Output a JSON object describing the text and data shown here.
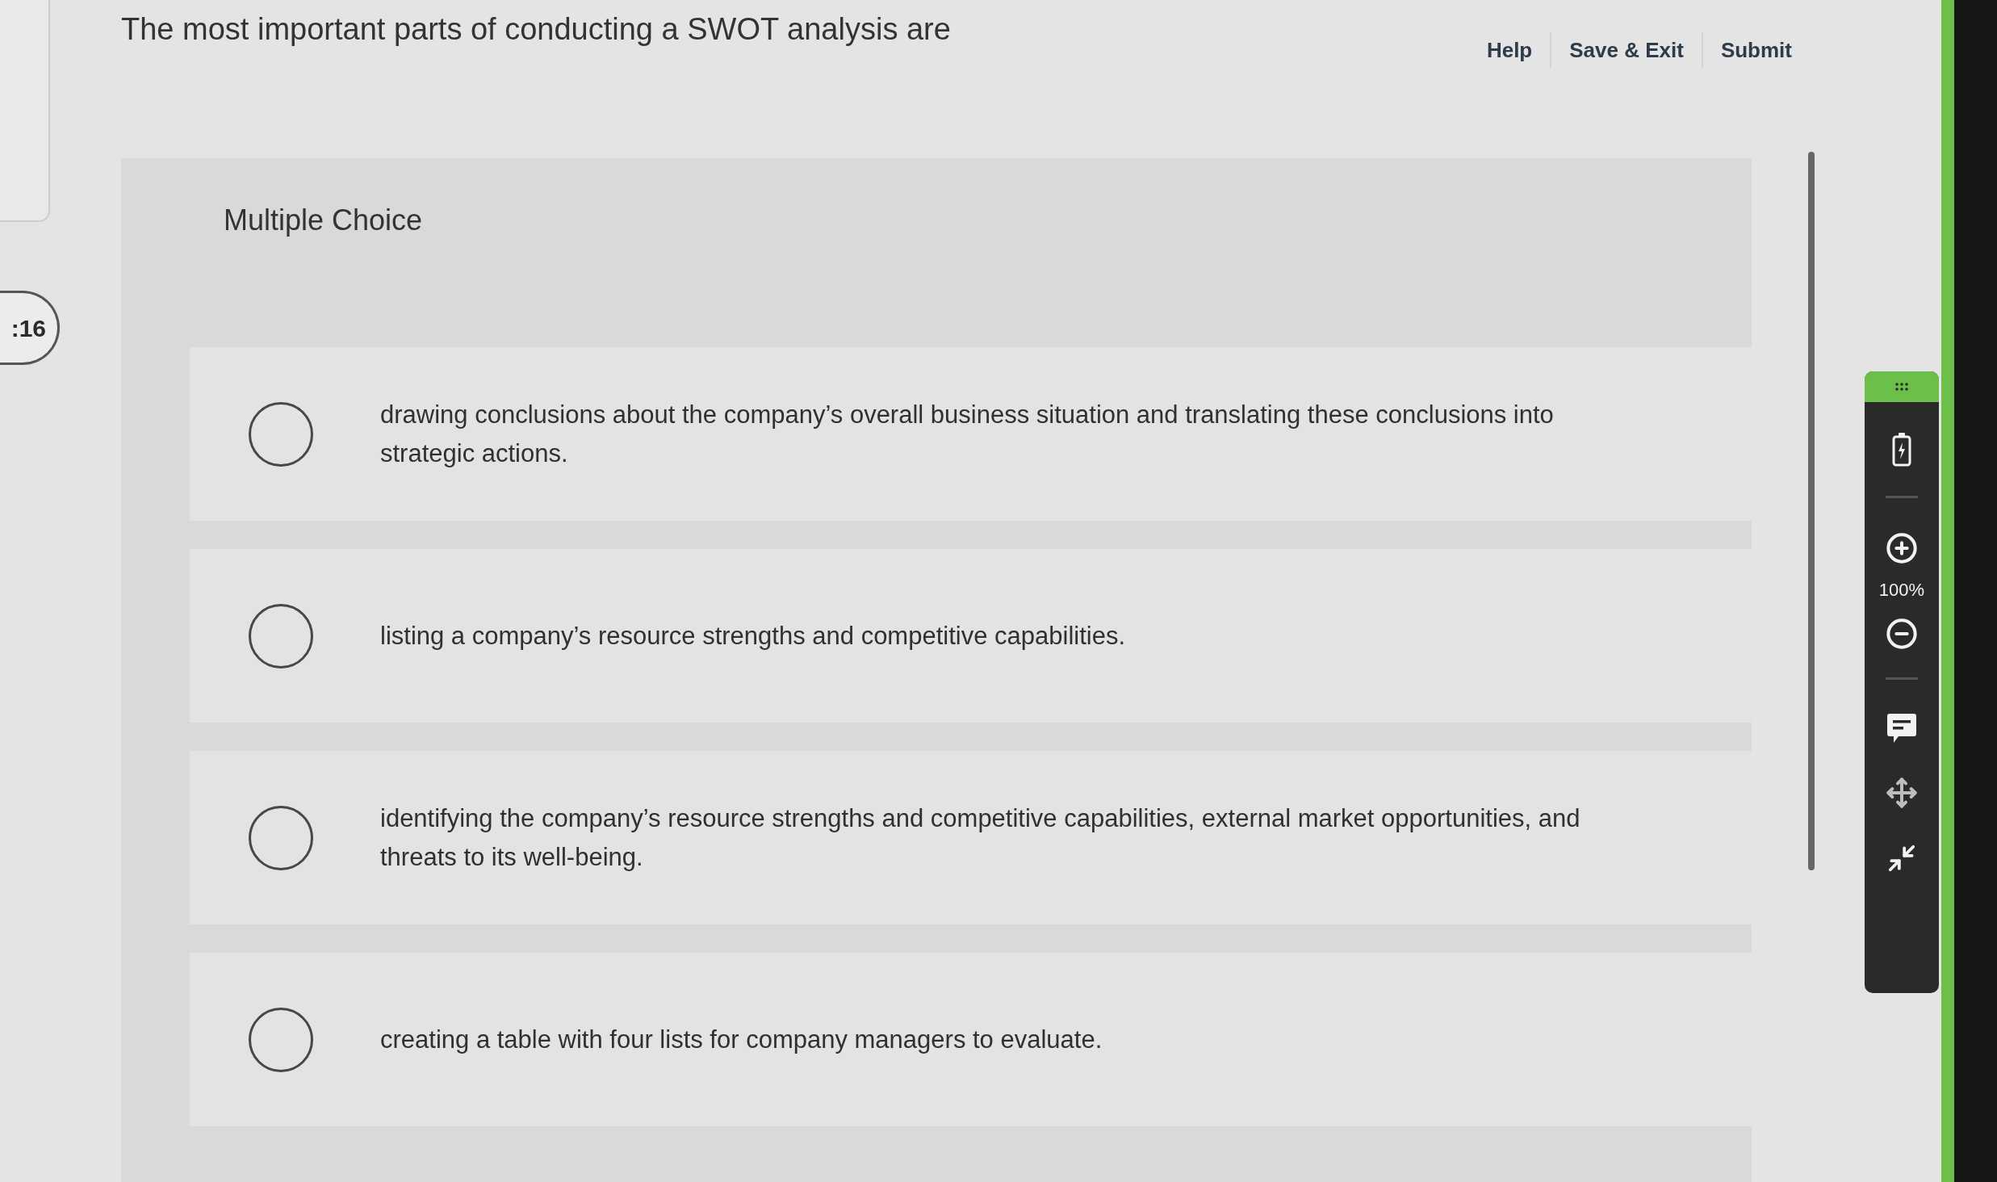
{
  "header": {
    "question": "The most important parts of conducting a SWOT analysis are",
    "links": [
      "Help",
      "Save & Exit",
      "Submit"
    ]
  },
  "timer": ":16",
  "question_card": {
    "type_label": "Multiple Choice",
    "options": [
      {
        "text": "drawing conclusions about the company’s overall business situation and translating these conclusions into strategic actions.",
        "selected": false
      },
      {
        "text": "listing a company’s resource strengths and competitive capabilities.",
        "selected": false
      },
      {
        "text": "identifying the company’s resource strengths and competitive capabilities, external market opportunities, and threats to its well-being.",
        "selected": false
      },
      {
        "text": "creating a table with four lists for company managers to evaluate.",
        "selected": false
      }
    ]
  },
  "toolbar": {
    "zoom_level": "100%"
  }
}
